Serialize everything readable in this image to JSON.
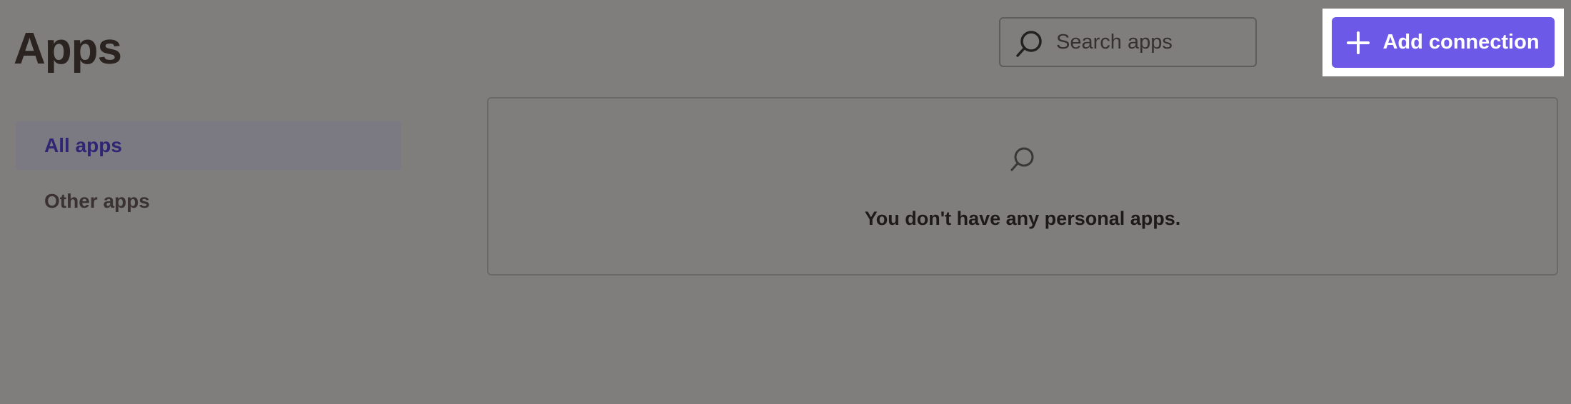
{
  "header": {
    "title": "Apps",
    "search": {
      "placeholder": "Search apps",
      "value": "",
      "icon": "search-icon"
    },
    "add_button": {
      "label": "Add connection",
      "icon": "plus-icon",
      "color": "#6c59e8"
    }
  },
  "sidebar": {
    "items": [
      {
        "label": "All apps",
        "active": true
      },
      {
        "label": "Other apps",
        "active": false
      }
    ]
  },
  "main": {
    "empty_state": {
      "icon": "search-icon",
      "message": "You don't have any personal apps."
    }
  }
}
